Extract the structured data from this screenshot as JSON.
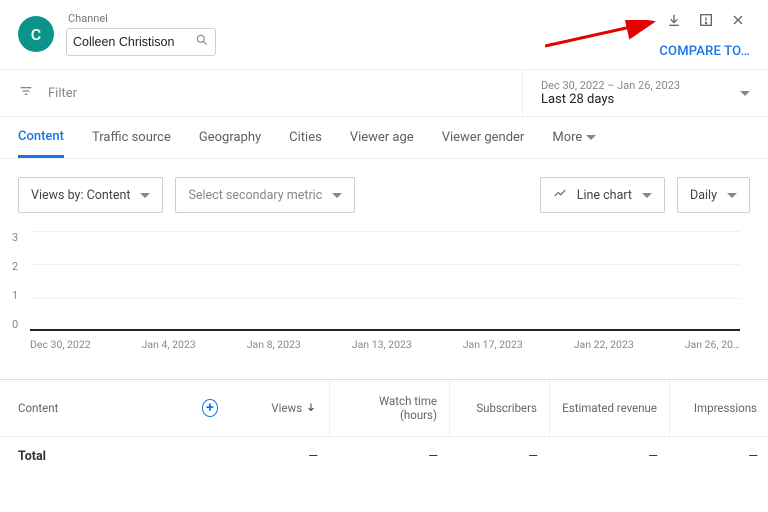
{
  "header": {
    "avatar_letter": "C",
    "channel_label": "Channel",
    "channel_name": "Colleen Christison",
    "compare_label": "COMPARE TO…"
  },
  "filter": {
    "placeholder": "Filter",
    "date_range": "Dec 30, 2022 – Jan 26, 2023",
    "date_preset": "Last 28 days"
  },
  "tabs": {
    "items": [
      "Content",
      "Traffic source",
      "Geography",
      "Cities",
      "Viewer age",
      "Viewer gender"
    ],
    "more_label": "More",
    "active_index": 0
  },
  "controls": {
    "views_by": "Views by: Content",
    "secondary_metric": "Select secondary metric",
    "chart_type": "Line chart",
    "granularity": "Daily"
  },
  "chart_data": {
    "type": "line",
    "title": "",
    "xlabel": "",
    "ylabel": "",
    "ylim": [
      0,
      3
    ],
    "y_ticks": [
      0,
      1,
      2,
      3
    ],
    "categories": [
      "Dec 30, 2022",
      "Jan 4, 2023",
      "Jan 8, 2023",
      "Jan 13, 2023",
      "Jan 17, 2023",
      "Jan 22, 2023",
      "Jan 26, 20…"
    ],
    "series": [
      {
        "name": "Views",
        "values": [
          0,
          0,
          0,
          0,
          0,
          0,
          0
        ]
      }
    ]
  },
  "table": {
    "columns": [
      "Content",
      "",
      "Views",
      "Watch time (hours)",
      "Subscribers",
      "Estimated revenue",
      "Impressions"
    ],
    "sort_column_index": 2,
    "rows": [
      {
        "label": "Total",
        "values": [
          "—",
          "—",
          "—",
          "—",
          "—"
        ]
      }
    ]
  }
}
